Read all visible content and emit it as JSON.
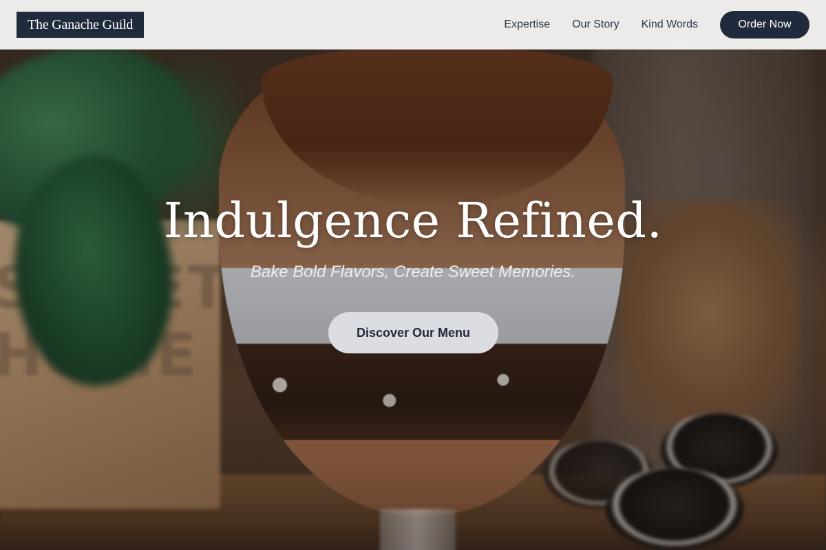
{
  "header": {
    "brand": "The Ganache Guild",
    "nav": [
      {
        "label": "Expertise"
      },
      {
        "label": "Our Story"
      },
      {
        "label": "Kind Words"
      }
    ],
    "cta_label": "Order Now"
  },
  "hero": {
    "title": "Indulgence Refined.",
    "subtitle": "Bake Bold Flavors, Create Sweet Memories.",
    "cta_label": "Discover Our Menu",
    "background_image": "chocolate-trifle-dessert-glass",
    "background_sign_text": "SWEET HOME"
  },
  "colors": {
    "brand_navy": "#1f2a3c",
    "header_bg": "#f8f8f7",
    "cta_light": "#dcdde2",
    "text_white": "#ffffff"
  }
}
